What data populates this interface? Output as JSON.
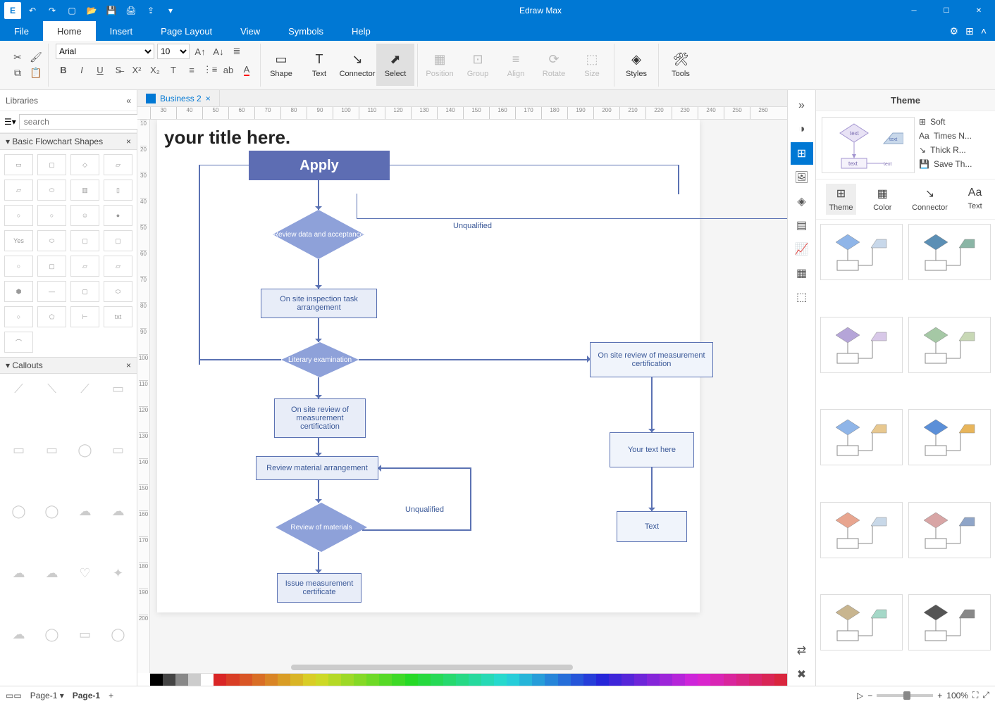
{
  "app": {
    "title": "Edraw Max"
  },
  "menu": {
    "tabs": [
      "File",
      "Home",
      "Insert",
      "Page Layout",
      "View",
      "Symbols",
      "Help"
    ],
    "active": 1
  },
  "ribbon": {
    "font_name": "Arial",
    "font_size": "10",
    "big": [
      "Shape",
      "Text",
      "Connector",
      "Select",
      "Position",
      "Group",
      "Align",
      "Rotate",
      "Size",
      "Styles",
      "Tools"
    ],
    "active_big": 3,
    "disabled_big": [
      4,
      5,
      6,
      7,
      8
    ]
  },
  "libraries": {
    "head": "Libraries",
    "search_placeholder": "search",
    "sections": [
      {
        "name": "Basic Flowchart Shapes",
        "count": 24
      },
      {
        "name": "Callouts",
        "count": 24
      }
    ]
  },
  "document": {
    "tab_name": "Business 2"
  },
  "canvas": {
    "title": "your title here.",
    "nodes": {
      "apply": "Apply",
      "review_data": "Review data and acceptance",
      "unqualified1": "Unqualified",
      "onsite_task": "On site inspection task arrangement",
      "literary": "Literary examination",
      "onsite_review_right": "On site review of measurement certification",
      "onsite_review": "On site review of measurement certification",
      "review_material": "Review material arrangement",
      "your_text": "Your text here",
      "unqualified2": "Unqualified",
      "review_materials": "Review of materials",
      "text": "Text",
      "issue_cert": "Issue measurement certificate"
    }
  },
  "theme": {
    "head": "Theme",
    "opts": [
      "Soft",
      "Times N...",
      "Thick R...",
      "Save Th..."
    ],
    "cats": [
      "Theme",
      "Color",
      "Connector",
      "Text"
    ],
    "active_cat": 0,
    "thumbs": 10
  },
  "status": {
    "page_sel": "Page-1",
    "page_tab": "Page-1",
    "zoom": "100%"
  },
  "ruler_h_start": 30,
  "ruler_h_step": 10,
  "ruler_h_count": 24,
  "ruler_v_start": 10,
  "ruler_v_step": 10,
  "ruler_v_count": 20
}
